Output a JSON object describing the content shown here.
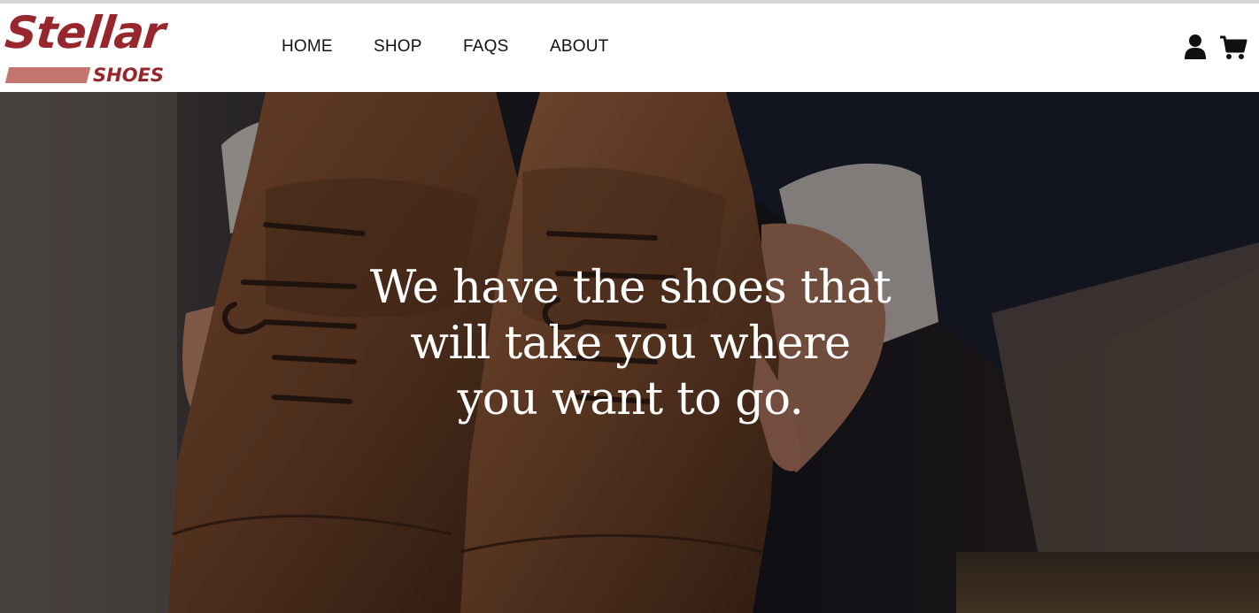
{
  "brand": {
    "name_main": "Stellar",
    "name_sub": "SHOES",
    "color_primary": "#97262d",
    "color_accent": "#c5756f"
  },
  "nav": {
    "items": [
      {
        "label": "HOME"
      },
      {
        "label": "SHOP"
      },
      {
        "label": "FAQS"
      },
      {
        "label": "ABOUT"
      }
    ],
    "icons": [
      "user-icon",
      "cart-icon"
    ]
  },
  "hero": {
    "headline_lines": [
      "We have the shoes that",
      "will take you where",
      "you want to go."
    ],
    "image": "brown-leather-oxford-shoes-held-in-hands"
  }
}
